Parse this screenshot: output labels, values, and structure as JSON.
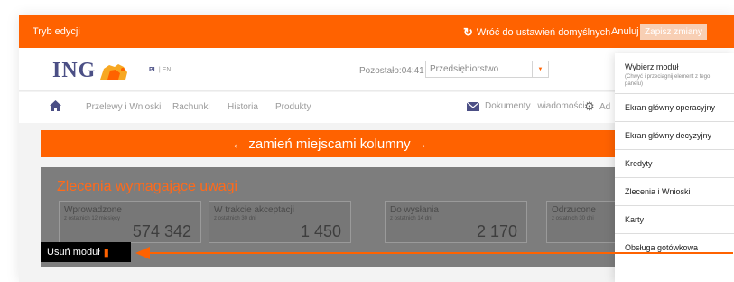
{
  "editbar": {
    "title": "Tryb edycji",
    "restore_label": "Wróć do ustawień domyślnych",
    "cancel_label": "Anuluj",
    "save_label": "Zapisz zmiany"
  },
  "header": {
    "logo_text": "ING",
    "lang_active": "PL",
    "lang_sep": " | ",
    "lang_other": "EN",
    "timer": "Pozostało:04:41",
    "profile_value": "Przedsiębiorstwo"
  },
  "nav": {
    "items": [
      "Przelewy i Wnioski",
      "Rachunki",
      "Historia",
      "Produkty"
    ],
    "docs_label": "Dokumenty i wiadomości",
    "admin_label": "Ad"
  },
  "banner": {
    "label": "← zamień miejscami kolumny →"
  },
  "module": {
    "title": "Zlecenia wymagające uwagi",
    "cards": [
      {
        "label": "Wprowadzone",
        "sub": "z ostatnich 12 miesięcy",
        "value": "574 342"
      },
      {
        "label": "W trakcie akceptacji",
        "sub": "z ostatnich 30 dni",
        "value": "1 450"
      },
      {
        "label": "Do wysłania",
        "sub": "z ostatnich 14 dni",
        "value": "2 170"
      },
      {
        "label": "Odrzucone",
        "sub": "z ostatnich 30 dni",
        "value": ""
      }
    ],
    "remove_label": "Usuń moduł"
  },
  "panel": {
    "title": "Wybierz moduł",
    "subtitle": "(Chwyć i przeciągnij element z tego panelu)",
    "items": [
      "Ekran główny operacyjny",
      "Ekran główny decyzyjny",
      "Kredyty",
      "Zlecenia i Wnioski",
      "Karty",
      "Obsługa gotówkowa"
    ]
  },
  "colors": {
    "accent": "#ff6200",
    "logo": "#4b4f85",
    "module_bg": "#7d7d7d",
    "stage_bg": "#f3f3f3"
  }
}
